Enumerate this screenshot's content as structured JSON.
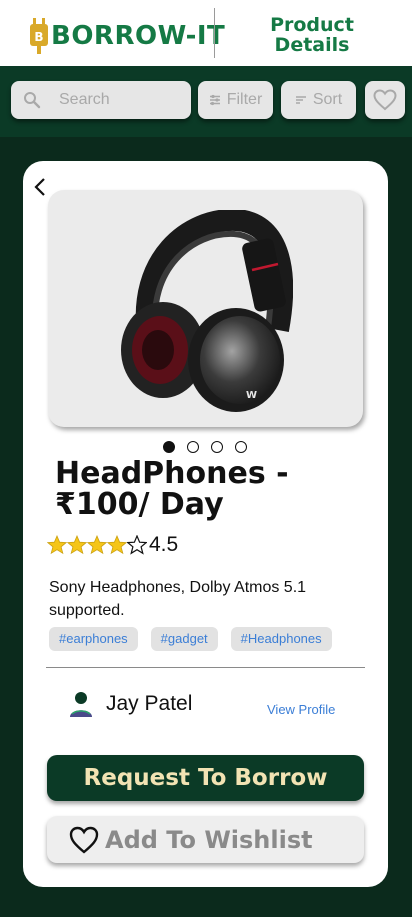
{
  "app": {
    "brand": "BORROW-IT",
    "brand_color": "#157a45",
    "page_title": "Product Details"
  },
  "toolbar": {
    "search": {
      "placeholder": "Search",
      "icon": "search-icon"
    },
    "filter_label": "Filter",
    "sort_label": "Sort",
    "wishlist_icon": "heart-icon"
  },
  "product": {
    "image_icon": "headphones-image",
    "carousel": {
      "total": 4,
      "active": 1
    },
    "title": "HeadPhones - ₹100/ Day",
    "rating": {
      "stars_filled": 4,
      "stars_total": 5,
      "value": "4.5"
    },
    "description": "Sony Headphones, Dolby Atmos 5.1 supported.",
    "tags": [
      "#earphones",
      "#gadget",
      "#Headphones"
    ]
  },
  "owner": {
    "name": "Jay Patel",
    "view_profile_label": "View Profile"
  },
  "actions": {
    "request_label": "Request To Borrow",
    "wishlist_label": "Add To Wishlist"
  },
  "colors": {
    "background": "#0b2a1c",
    "toolbar": "#0b3a26",
    "primary_button": "#0b3a26",
    "primary_button_text": "#f2e3b3",
    "tag_text": "#3b7ed6",
    "star": "#f5c518"
  }
}
